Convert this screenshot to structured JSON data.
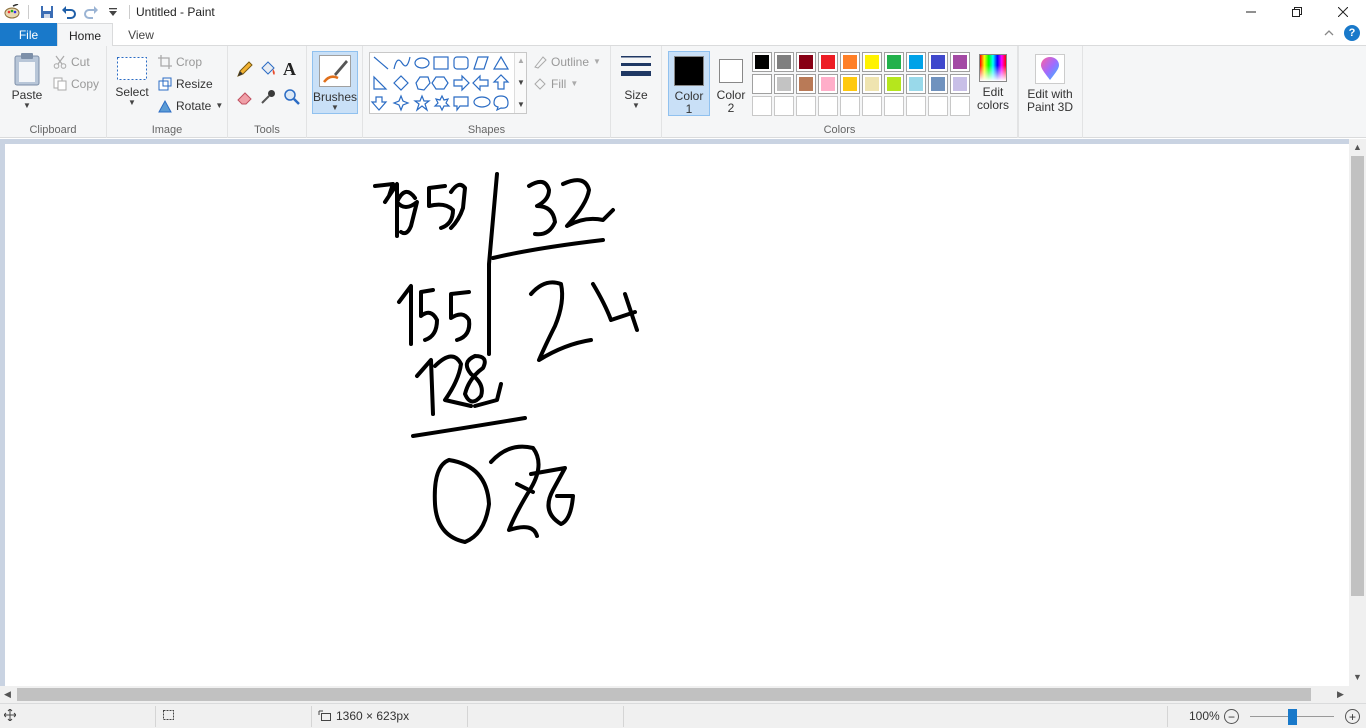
{
  "window": {
    "title": "Untitled - Paint",
    "controls": {
      "minimize": "—",
      "maximize": "☐",
      "close": "✕"
    }
  },
  "tabs": {
    "file": "File",
    "home": "Home",
    "view": "View"
  },
  "ribbon": {
    "clipboard": {
      "label": "Clipboard",
      "paste": "Paste",
      "cut": "Cut",
      "copy": "Copy"
    },
    "image": {
      "label": "Image",
      "select": "Select",
      "crop": "Crop",
      "resize": "Resize",
      "rotate": "Rotate"
    },
    "tools": {
      "label": "Tools"
    },
    "brushes": {
      "label": "Brushes"
    },
    "shapes": {
      "label": "Shapes",
      "outline": "Outline",
      "fill": "Fill"
    },
    "size": {
      "label": "Size"
    },
    "colors": {
      "label": "Colors",
      "color1_line1": "Color",
      "color1_line2": "1",
      "color2_line1": "Color",
      "color2_line2": "2",
      "edit_line1": "Edit",
      "edit_line2": "colors",
      "color1_value": "#000000",
      "color2_value": "#ffffff",
      "palette_row1": [
        "#000000",
        "#7f7f7f",
        "#880015",
        "#ed1c24",
        "#ff7f27",
        "#fff200",
        "#22b14c",
        "#00a2e8",
        "#3f48cc",
        "#a349a4"
      ],
      "palette_row2": [
        "#ffffff",
        "#c3c3c3",
        "#b97a57",
        "#ffaec9",
        "#ffc90e",
        "#efe4b0",
        "#b5e61d",
        "#99d9ea",
        "#7092be",
        "#c8bfe7"
      ]
    },
    "paint3d": {
      "line1": "Edit with",
      "line2": "Paint 3D"
    }
  },
  "status": {
    "dimensions": "1360 × 623px",
    "zoom": "100%"
  }
}
